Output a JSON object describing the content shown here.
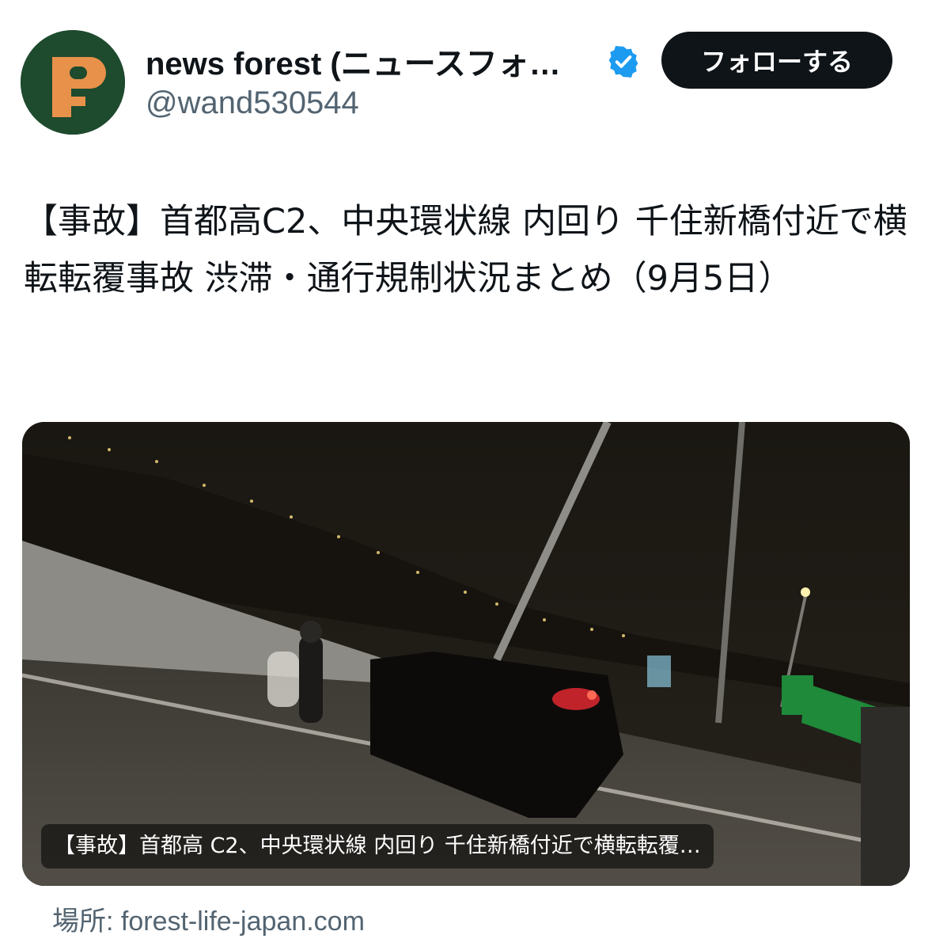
{
  "author": {
    "display_name": "news forest (ニュースフォ…",
    "handle": "@wand530544",
    "avatar_icon": "news-forest-logo-icon",
    "verified_icon": "verified-badge-icon",
    "verified_color": "#1d9bf0"
  },
  "follow_button": {
    "label": "フォローする"
  },
  "tweet": {
    "text": "【事故】首都高C2、中央環状線 内回り 千住新橋付近で横転転覆事故 渋滞・通行規制状況まとめ（9月5日）"
  },
  "link_card": {
    "caption": "【事故】首都高 C2、中央環状線 内回り 千住新橋付近で横転転覆…",
    "source_label": "場所: forest-life-japan.com",
    "image_description_icon": "accident-photo"
  },
  "colors": {
    "text_primary": "#0f1419",
    "text_secondary": "#536471",
    "follow_button_bg": "#0f1419",
    "avatar_bg": "#1e4a2e",
    "logo_orange": "#e8914a"
  }
}
